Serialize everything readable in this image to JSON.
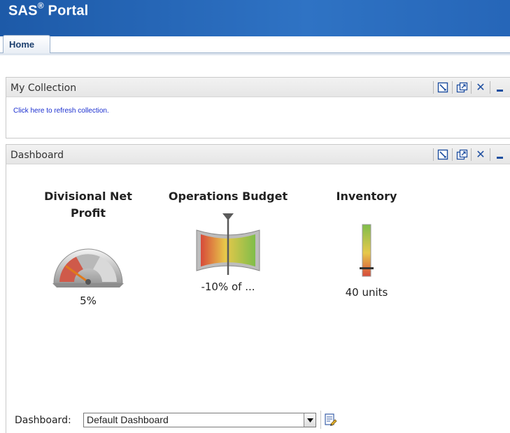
{
  "header": {
    "brand": "SAS",
    "registered": "®",
    "product": "Portal",
    "tabs": [
      {
        "label": "Home"
      }
    ]
  },
  "collection": {
    "title": "My Collection",
    "refresh_link": "Click here to refresh collection."
  },
  "dashboard": {
    "title": "Dashboard",
    "gauges": [
      {
        "title_line1": "Divisional Net",
        "title_line2": "Profit",
        "value_label": "5%",
        "type": "speedometer",
        "level": 0.3
      },
      {
        "title_line1": "Operations Budget",
        "title_line2": "",
        "value_label": "-10% of ...",
        "type": "bowtie",
        "level": 0.5
      },
      {
        "title_line1": "Inventory",
        "title_line2": "",
        "value_label": "40 units",
        "type": "slider",
        "level": 0.15
      }
    ],
    "selector_label": "Dashboard:",
    "selected_dashboard": "Default Dashboard"
  },
  "portlet_tools": [
    "edit-icon",
    "popout-icon",
    "close-icon",
    "minimize-icon"
  ],
  "colors": {
    "banner": "#2a6cbd",
    "link": "#1b2fd0",
    "tool_icons": "#1f4fa0"
  }
}
